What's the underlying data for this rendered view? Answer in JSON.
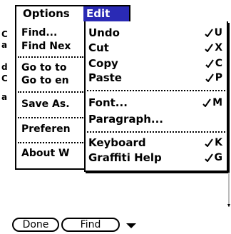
{
  "background_fragments": [
    "C",
    "a",
    "d",
    "C",
    "a"
  ],
  "menubar": {
    "options_label": "Options",
    "edit_label": "Edit",
    "active_color": "#2a2ab5"
  },
  "options_menu": {
    "items": [
      "Find...",
      "Find Nex",
      "Go to to",
      "Go to en",
      "Save As.",
      "Preferen",
      "About W"
    ]
  },
  "edit_menu": {
    "items": [
      {
        "label": "Undo",
        "shortcut": "U"
      },
      {
        "label": "Cut",
        "shortcut": "X"
      },
      {
        "label": "Copy",
        "shortcut": "C"
      },
      {
        "label": "Paste",
        "shortcut": "P"
      },
      {
        "label": "Font...",
        "shortcut": "M"
      },
      {
        "label": "Paragraph...",
        "shortcut": ""
      },
      {
        "label": "Keyboard",
        "shortcut": "K"
      },
      {
        "label": "Graffiti Help",
        "shortcut": "G"
      }
    ],
    "shortcut_icon": "graffiti-stroke-icon"
  },
  "buttons": {
    "done": "Done",
    "find": "Find"
  }
}
